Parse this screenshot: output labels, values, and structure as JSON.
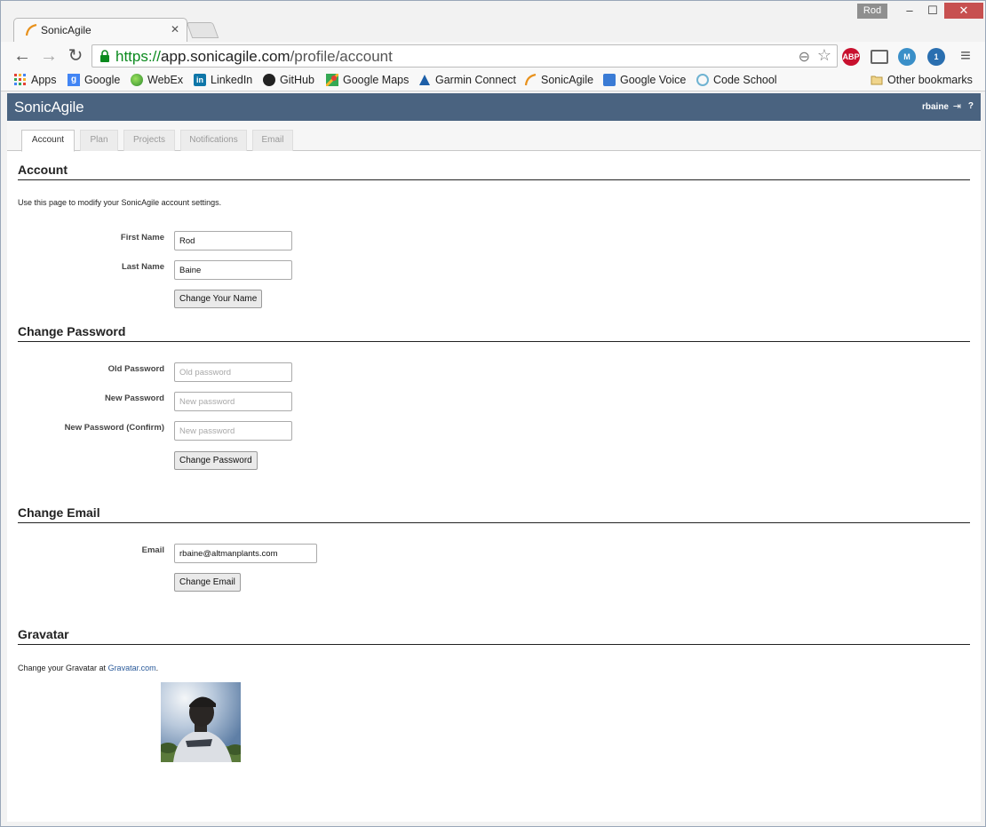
{
  "browser": {
    "tab_title": "SonicAgile",
    "profile_name": "Rod",
    "url_scheme": "https://",
    "url_domain": "app.sonicagile.com",
    "url_path": "/profile/account",
    "bookmarks": [
      {
        "label": "Apps",
        "icon": "apps-grid-icon"
      },
      {
        "label": "Google",
        "icon": "google-icon"
      },
      {
        "label": "WebEx",
        "icon": "webex-icon"
      },
      {
        "label": "LinkedIn",
        "icon": "linkedin-icon"
      },
      {
        "label": "GitHub",
        "icon": "github-icon"
      },
      {
        "label": "Google Maps",
        "icon": "google-maps-icon"
      },
      {
        "label": "Garmin Connect",
        "icon": "garmin-icon"
      },
      {
        "label": "SonicAgile",
        "icon": "sonicagile-icon"
      },
      {
        "label": "Google Voice",
        "icon": "google-voice-icon"
      },
      {
        "label": "Code School",
        "icon": "code-school-icon"
      },
      {
        "label": "Other bookmarks",
        "icon": "folder-icon"
      }
    ],
    "extensions": [
      {
        "name": "abp-icon",
        "text": "ABP",
        "color": "#c8102e"
      },
      {
        "name": "cast-icon",
        "text": "",
        "color": "#555555"
      },
      {
        "name": "mightytext-icon",
        "text": "M",
        "color": "#3a8fc8"
      },
      {
        "name": "phone-icon",
        "text": "1",
        "color": "#2a6fb0"
      }
    ]
  },
  "app": {
    "logo": "SonicAgile",
    "username": "rbaine",
    "help": "?",
    "tabs": [
      "Account",
      "Plan",
      "Projects",
      "Notifications",
      "Email"
    ]
  },
  "account": {
    "heading": "Account",
    "description": "Use this page to modify your SonicAgile account settings.",
    "first_name_label": "First Name",
    "first_name_value": "Rod",
    "last_name_label": "Last Name",
    "last_name_value": "Baine",
    "change_name_button": "Change Your Name"
  },
  "password": {
    "heading": "Change Password",
    "old_label": "Old Password",
    "old_placeholder": "Old password",
    "new_label": "New Password",
    "new_placeholder": "New password",
    "confirm_label": "New Password (Confirm)",
    "confirm_placeholder": "New password",
    "button": "Change Password"
  },
  "email": {
    "heading": "Change Email",
    "label": "Email",
    "value": "rbaine@altmanplants.com",
    "button": "Change Email"
  },
  "gravatar": {
    "heading": "Gravatar",
    "text_before": "Change your Gravatar at ",
    "link": "Gravatar.com",
    "text_after": "."
  }
}
